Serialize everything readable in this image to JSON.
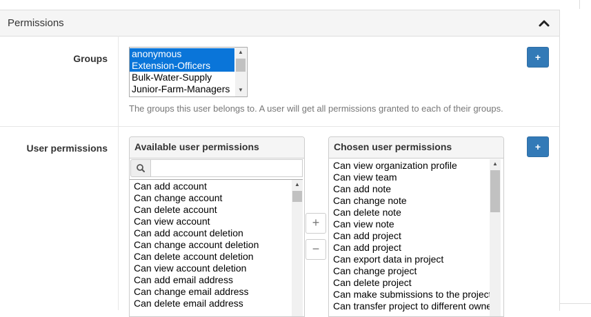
{
  "panel": {
    "title": "Permissions"
  },
  "groups": {
    "label": "Groups",
    "options": [
      {
        "label": "anonymous",
        "selected": true
      },
      {
        "label": "Extension-Officers",
        "selected": true
      },
      {
        "label": "Bulk-Water-Supply",
        "selected": false
      },
      {
        "label": "Junior-Farm-Managers",
        "selected": false
      }
    ],
    "add_label": "+",
    "help_text": "The groups this user belongs to. A user will get all permissions granted to each of their groups."
  },
  "user_permissions": {
    "label": "User permissions",
    "available": {
      "title": "Available user permissions",
      "filter_value": "",
      "items": [
        "Can add account",
        "Can change account",
        "Can delete account",
        "Can view account",
        "Can add account deletion",
        "Can change account deletion",
        "Can delete account deletion",
        "Can view account deletion",
        "Can add email address",
        "Can change email address",
        "Can delete email address"
      ]
    },
    "chosen": {
      "title": "Chosen user permissions",
      "items": [
        "Can view organization profile",
        "Can view team",
        "Can add note",
        "Can change note",
        "Can delete note",
        "Can view note",
        "Can add project",
        "Can add project",
        "Can export data in project",
        "Can change project",
        "Can delete project",
        "Can make submissions to the project",
        "Can transfer project to different owner"
      ]
    },
    "add_selected_label": "+",
    "remove_selected_label": "−",
    "add_label": "+"
  },
  "colors": {
    "selection": "#0a75d9",
    "primary_button": "#337ab7"
  }
}
